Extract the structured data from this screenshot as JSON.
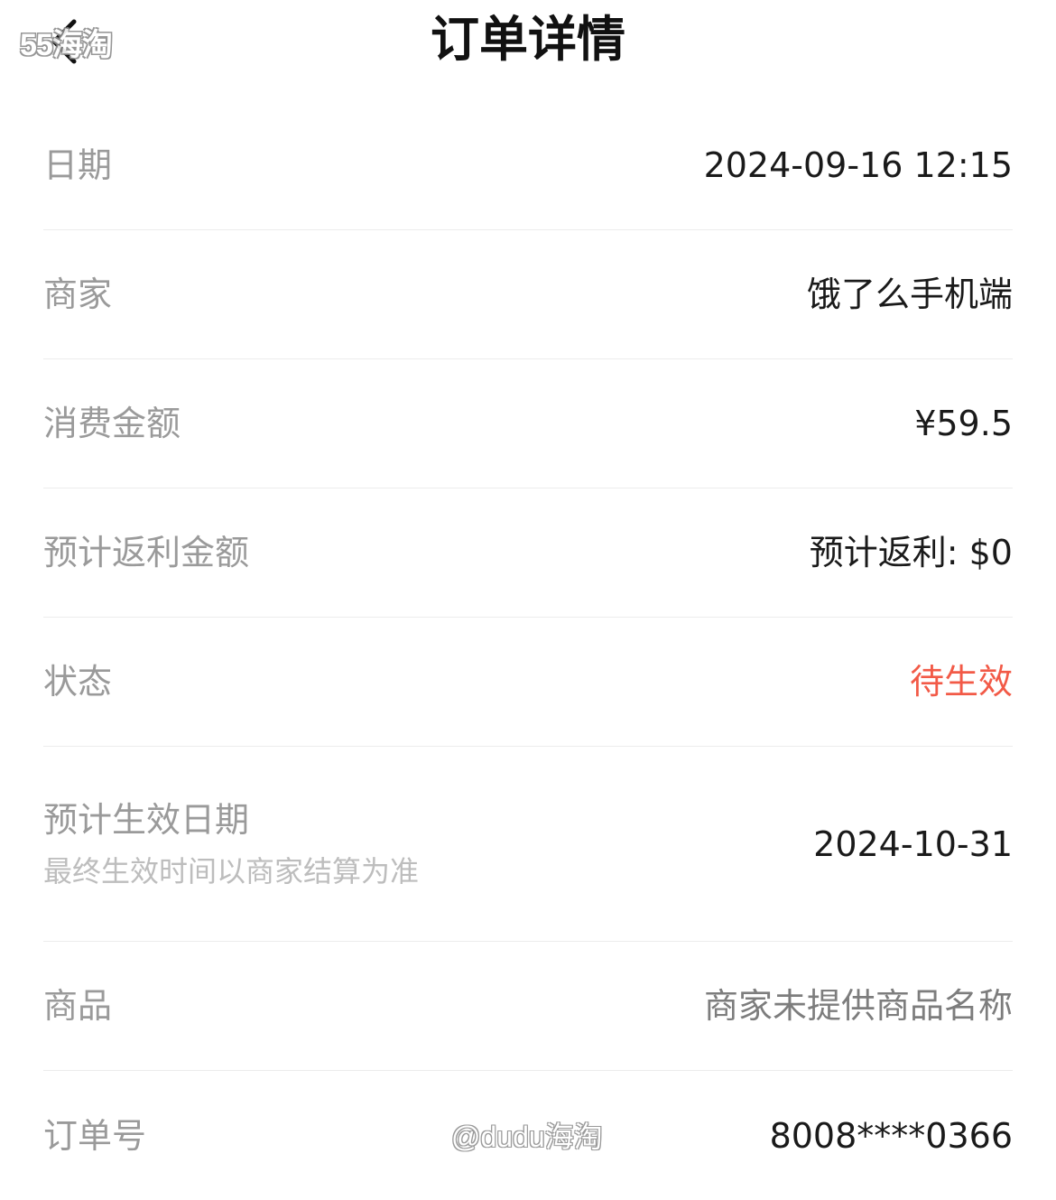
{
  "watermark_top": "55海淘",
  "watermark_bottom": "@dudu海淘",
  "header": {
    "title": "订单详情",
    "back_icon": "chevron-left-icon"
  },
  "rows": [
    {
      "label": "日期",
      "value": "2024-09-16 12:15"
    },
    {
      "label": "商家",
      "value": "饿了么手机端"
    },
    {
      "label": "消费金额",
      "value": "¥59.5"
    },
    {
      "label": "预计返利金额",
      "value": "预计返利: $0"
    },
    {
      "label": "状态",
      "value": "待生效"
    },
    {
      "label": "预计生效日期",
      "sublabel": "最终生效时间以商家结算为准",
      "value": "2024-10-31"
    },
    {
      "label": "商品",
      "value": "商家未提供商品名称"
    },
    {
      "label": "订单号",
      "value": "8008****0366"
    }
  ],
  "colors": {
    "status": "#f25a47",
    "label": "#9a9a9a",
    "value": "#1a1a1a"
  }
}
